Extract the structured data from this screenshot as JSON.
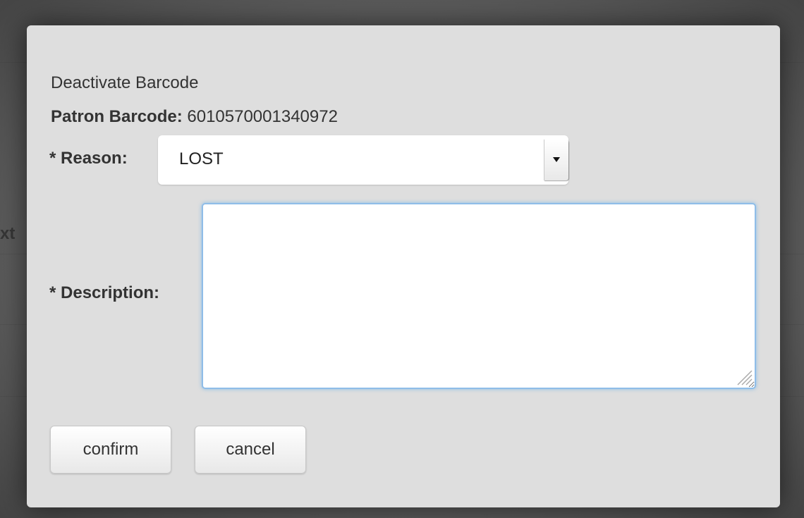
{
  "background": {
    "partial_text": "xt"
  },
  "dialog": {
    "title": "Deactivate Barcode",
    "patron_barcode_label": "Patron Barcode:",
    "patron_barcode_value": "6010570001340972",
    "reason_label": "* Reason:",
    "reason_selected": "LOST",
    "description_label": "* Description:",
    "description_value": "",
    "confirm_label": "confirm",
    "cancel_label": "cancel"
  },
  "colors": {
    "focus_border": "#8fbde8",
    "modal_bg": "#dedede"
  },
  "icons": {
    "select_arrow": "chevron-down-icon",
    "resize_grip": "resize-grip-icon"
  }
}
